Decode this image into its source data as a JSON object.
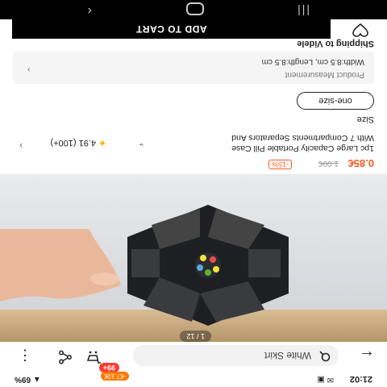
{
  "status_bar": {
    "time": "21:02",
    "left_icons": "✉ ▣",
    "right": "▲ 69%"
  },
  "topbar": {
    "search_text": "White Skirt",
    "cart_badge": "99+",
    "cart_promo": "-€7.10€"
  },
  "gallery": {
    "counter": "1 / 12"
  },
  "product": {
    "price_sale": "0.85€",
    "price_old": "1.09€",
    "discount": "-15%",
    "title_line1": "1pc Large Capacity Portable Pill Case",
    "title_line2": "With 7 Compartments Separators And",
    "rating_value": "4.91",
    "rating_count": "(100+)",
    "size_label": "Size",
    "size_option": "one-size",
    "measure_title": "Product Measurement",
    "measure_value": "Width:8.5 cm, Length:8.5 cm",
    "shipping": "Shipping to Videle"
  },
  "bottom": {
    "add_to_cart": "ADD TO CART"
  },
  "icons": {
    "back": "arrow-left",
    "search": "search",
    "cart": "cart",
    "share": "share",
    "more": "more-vertical",
    "wishlist": "heart"
  },
  "colors": {
    "accent": "#ff5a1f",
    "button": "#000000"
  }
}
